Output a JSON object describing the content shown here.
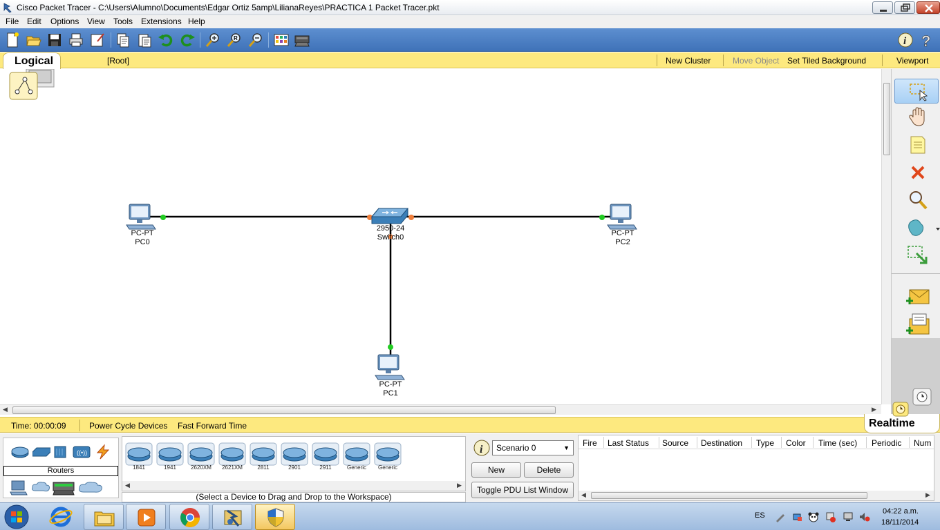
{
  "window": {
    "title": "Cisco Packet Tracer - C:\\Users\\Alumno\\Documents\\Edgar Ortiz 5amp\\LilianaReyes\\PRACTICA 1 Packet Tracer.pkt"
  },
  "menu": [
    "File",
    "Edit",
    "Options",
    "View",
    "Tools",
    "Extensions",
    "Help"
  ],
  "toolbar": {
    "icons": [
      "new-icon",
      "open-icon",
      "save-icon",
      "print-icon",
      "activity-wizard-icon",
      "copy-icon",
      "paste-icon",
      "undo-icon",
      "redo-icon",
      "zoom-in-icon",
      "zoom-reset-icon",
      "zoom-out-icon",
      "palette-icon",
      "custom-device-icon",
      "info-icon",
      "help-icon"
    ]
  },
  "logical_bar": {
    "tab_label": "Logical",
    "root": "[Root]",
    "new_cluster": "New Cluster",
    "move_object": "Move Object",
    "set_tiled_background": "Set Tiled Background",
    "viewport": "Viewport"
  },
  "topology": {
    "devices": [
      {
        "model": "PC-PT",
        "name": "PC0"
      },
      {
        "model": "2950-24",
        "name": "Switch0"
      },
      {
        "model": "PC-PT",
        "name": "PC2"
      },
      {
        "model": "PC-PT",
        "name": "PC1"
      }
    ]
  },
  "right_tools": [
    "select-icon",
    "hand-icon",
    "note-icon",
    "delete-icon",
    "inspect-icon",
    "draw-shape-icon",
    "resize-icon",
    "simple-pdu-icon",
    "complex-pdu-icon"
  ],
  "realtime_bar": {
    "time": "Time: 00:00:09",
    "power_cycle": "Power Cycle Devices",
    "fast_forward": "Fast Forward Time",
    "mode": "Realtime"
  },
  "device_panel": {
    "category_label": "Routers",
    "models": [
      "1841",
      "1941",
      "2620XM",
      "2621XM",
      "2811",
      "2901",
      "2911",
      "Generic",
      "Generic"
    ],
    "hint": "(Select a Device to Drag and Drop to the Workspace)"
  },
  "scenario": {
    "selected": "Scenario 0",
    "new_label": "New",
    "delete_label": "Delete",
    "toggle_label": "Toggle PDU List Window"
  },
  "pdu_table": {
    "columns": [
      "Fire",
      "Last Status",
      "Source",
      "Destination",
      "Type",
      "Color",
      "Time (sec)",
      "Periodic",
      "Num"
    ]
  },
  "taskbar": {
    "lang": "ES",
    "time": "04:22 a.m.",
    "date": "18/11/2014"
  },
  "colors": {
    "toolbar_blue": "#4a7fc4",
    "yellow_bar": "#fde97f",
    "link_up": "#22cc22",
    "link_negotiating": "#f07f3c"
  }
}
